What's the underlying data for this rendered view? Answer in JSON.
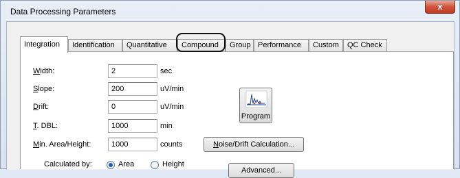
{
  "window": {
    "title": "Data Processing Parameters",
    "close_label": "x"
  },
  "tabs": [
    {
      "label": "Integration"
    },
    {
      "label": "Identification"
    },
    {
      "label": "Quantitative"
    },
    {
      "label": "Compound"
    },
    {
      "label": "Group"
    },
    {
      "label": "Performance"
    },
    {
      "label": "Custom"
    },
    {
      "label": "QC Check"
    }
  ],
  "fields": [
    {
      "mnemonic": "W",
      "label_rest": "idth:",
      "value": "2",
      "unit": "sec"
    },
    {
      "mnemonic": "S",
      "label_rest": "lope:",
      "value": "200",
      "unit": "uV/min"
    },
    {
      "mnemonic": "D",
      "label_rest": "rift:",
      "value": "0",
      "unit": "uV/min"
    },
    {
      "mnemonic": "T",
      "label_rest": ". DBL:",
      "value": "1000",
      "unit": "min"
    },
    {
      "mnemonic": "M",
      "label_rest": "in. Area/Height:",
      "value": "1000",
      "unit": "counts"
    }
  ],
  "program_button": "Program",
  "noise_button": {
    "mnemonic": "N",
    "rest": "oise/Drift Calculation..."
  },
  "calculated_by": {
    "label": "Calculated by:",
    "options": [
      {
        "label": "Area",
        "selected": true
      },
      {
        "label": "Height",
        "selected": false
      }
    ]
  },
  "advanced_button": "Advanced..."
}
